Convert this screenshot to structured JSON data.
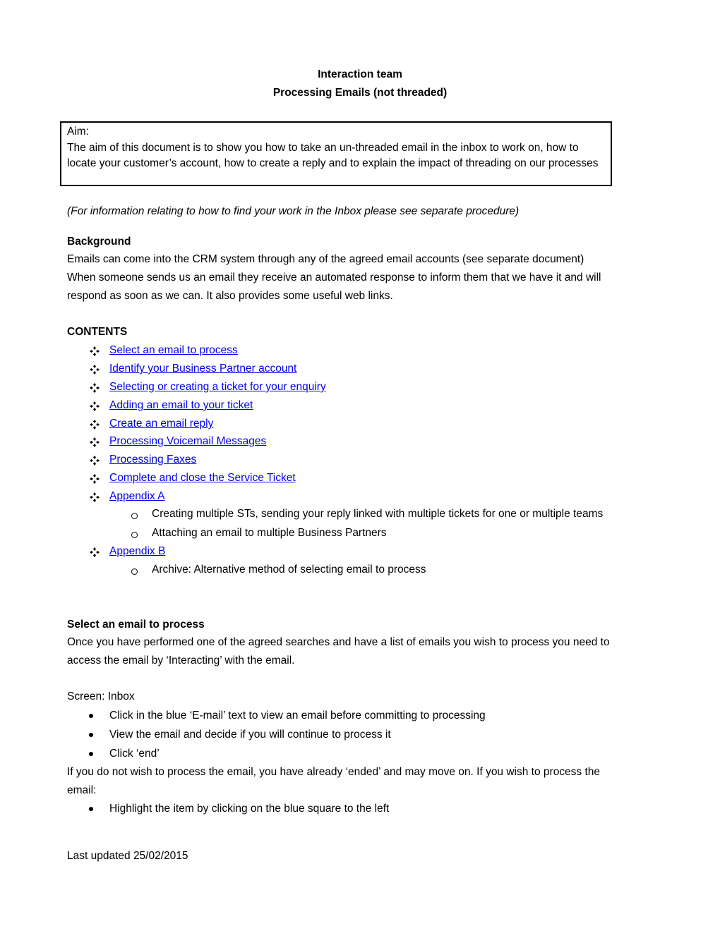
{
  "header": {
    "line1": "Interaction team",
    "line2": "Processing Emails (not threaded)"
  },
  "aim": {
    "label": "Aim:",
    "text": "The aim of this document is to show you how to take an un-threaded email in the inbox to work on, how to locate your customer’s account, how to create a reply and to explain the impact of threading on our processes"
  },
  "note": "(For information relating to how to find your work in the Inbox please see separate procedure)",
  "background": {
    "heading": "Background",
    "line1": "Emails can come into the CRM system through any of the agreed email accounts (see separate document)",
    "line2": "When someone sends us an email they receive an automated response to inform them that we have it and will",
    "line3": "respond as soon as we can. It also provides some useful web links."
  },
  "contents": {
    "heading": "CONTENTS",
    "items": [
      "Select an email to process",
      "Identify your Business Partner account",
      "Selecting or creating a ticket for your enquiry",
      "Adding an email to your ticket",
      "Create an email reply",
      "Processing Voicemail Messages",
      "Processing Faxes",
      "Complete and close the Service Ticket",
      "Appendix A",
      "Appendix B"
    ],
    "appendix_a_sub": [
      "Creating multiple STs, sending your reply linked with multiple tickets for one or multiple teams",
      "Attaching an email to multiple Business Partners"
    ],
    "appendix_b_sub": [
      "Archive: Alternative method of selecting email to process"
    ]
  },
  "select_section": {
    "heading": "Select an email to process",
    "para1_line1": "Once you have performed one of the agreed searches and have a list of emails you wish to process you need to",
    "para1_line2": "access the email by ‘Interacting’ with the email.",
    "screen": "Screen: Inbox",
    "bullets": [
      "Click in the blue ‘E-mail’ text to view an email before committing to processing",
      "View the email and decide if you will continue to process it",
      "Click ‘end’"
    ],
    "para2_line1": "If you do not wish to process the email, you have already ‘ended’ and may move on. If you wish to process the",
    "para2_line2": "email:",
    "bullets2": [
      "Highlight the item by clicking on the blue square to the left"
    ]
  },
  "footer": {
    "last_updated": "Last updated 25/02/2015"
  }
}
